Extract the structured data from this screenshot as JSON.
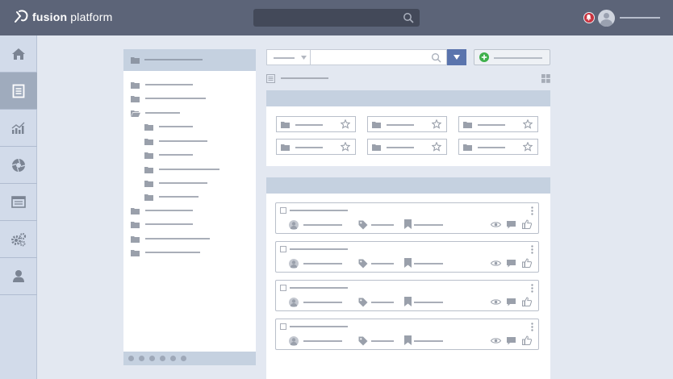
{
  "app": {
    "brand_bold": "fusion",
    "brand_rest": "platform"
  },
  "search": {
    "value": ""
  },
  "colors": {
    "topbar": "#5c6478",
    "sidebar": "#d2dbea",
    "accent": "#5a74ad",
    "notification": "#c9333f",
    "add": "#3eb04b"
  },
  "sidebar": {
    "items": [
      {
        "icon": "home-icon",
        "active": false
      },
      {
        "icon": "document-icon",
        "active": true
      },
      {
        "icon": "chart-icon",
        "active": false
      },
      {
        "icon": "aperture-icon",
        "active": false
      },
      {
        "icon": "browser-window-icon",
        "active": false
      },
      {
        "icon": "gears-icon",
        "active": false
      },
      {
        "icon": "user-icon",
        "active": false
      }
    ]
  },
  "tree": {
    "pagination_dots": 6
  },
  "favorites": {
    "count": 6
  },
  "items": {
    "count": 4
  }
}
